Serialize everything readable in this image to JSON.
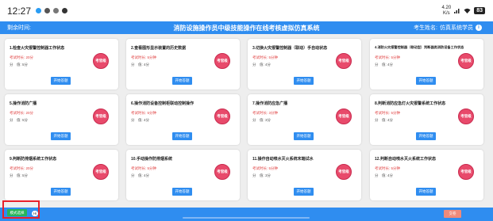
{
  "status": {
    "time": "12:27",
    "network_speed_value": "4.20",
    "network_speed_unit": "K/s",
    "battery": "83"
  },
  "header": {
    "remaining_label": "剩余时间:",
    "title": "消防设施操作员中级技能操作在线考核虚拟仿真系统",
    "candidate_label": "考生姓名:",
    "candidate_name": "仿真系统学员"
  },
  "card_labels": {
    "start_button": "开始答题",
    "stamp_text": "考官级"
  },
  "cards": [
    {
      "title": "1.检查火灾报警控制器工作状态",
      "meta1": "考试时长: 20分",
      "meta2": "分　值: 5分"
    },
    {
      "title": "2.查看图形显示装置的历史数据",
      "meta1": "考试时长: 5分钟",
      "meta2": "分　值: 4分"
    },
    {
      "title": "3.切换火灾报警控制器（联动）手自动状态",
      "meta1": "考试时长: 5分钟",
      "meta2": "分　值: 4分"
    },
    {
      "title": "4.消防火灾报警控制器（联动型）判断器类消防设备工作状态",
      "meta1": "考试时长: 5分钟",
      "meta2": "分　值: 4分"
    },
    {
      "title": "5.操作消防广播",
      "meta1": "考试时长: 20分",
      "meta2": "分　值: 5分"
    },
    {
      "title": "6.操作消防设备控制柜联动控制操作",
      "meta1": "考试时长: 5分钟",
      "meta2": "分　值: 4分"
    },
    {
      "title": "7.操作消防应急广播",
      "meta1": "考试时长: 3分钟",
      "meta2": "分　值: 3分"
    },
    {
      "title": "8.判断消防应急灯火灾报警系统工作状态",
      "meta1": "考试时长: 5分钟",
      "meta2": "分　值: 4分"
    },
    {
      "title": "9.判断防排烟系统工作状态",
      "meta1": "考试时长: 20分",
      "meta2": "分　值: 5分"
    },
    {
      "title": "10.手动操作防排烟系统",
      "meta1": "考试时长: 5分钟",
      "meta2": "分　值: 4分"
    },
    {
      "title": "11.操作自动喷水灭火系统末端试水",
      "meta1": "考试时长: 5分钟",
      "meta2": "分　值: 3分"
    },
    {
      "title": "12.判断自动喷水灭火系统工作状态",
      "meta1": "考试时长: 5分钟",
      "meta2": "分　值: 4分"
    }
  ],
  "footer": {
    "mode_button": "模式选择",
    "toggle_label": "Hi",
    "submit_button": "交卷"
  },
  "colors": {
    "primary": "#2f8df0",
    "stamp": "#e84a6b",
    "mode_button": "#26b55a",
    "highlight": "#e8202a"
  }
}
